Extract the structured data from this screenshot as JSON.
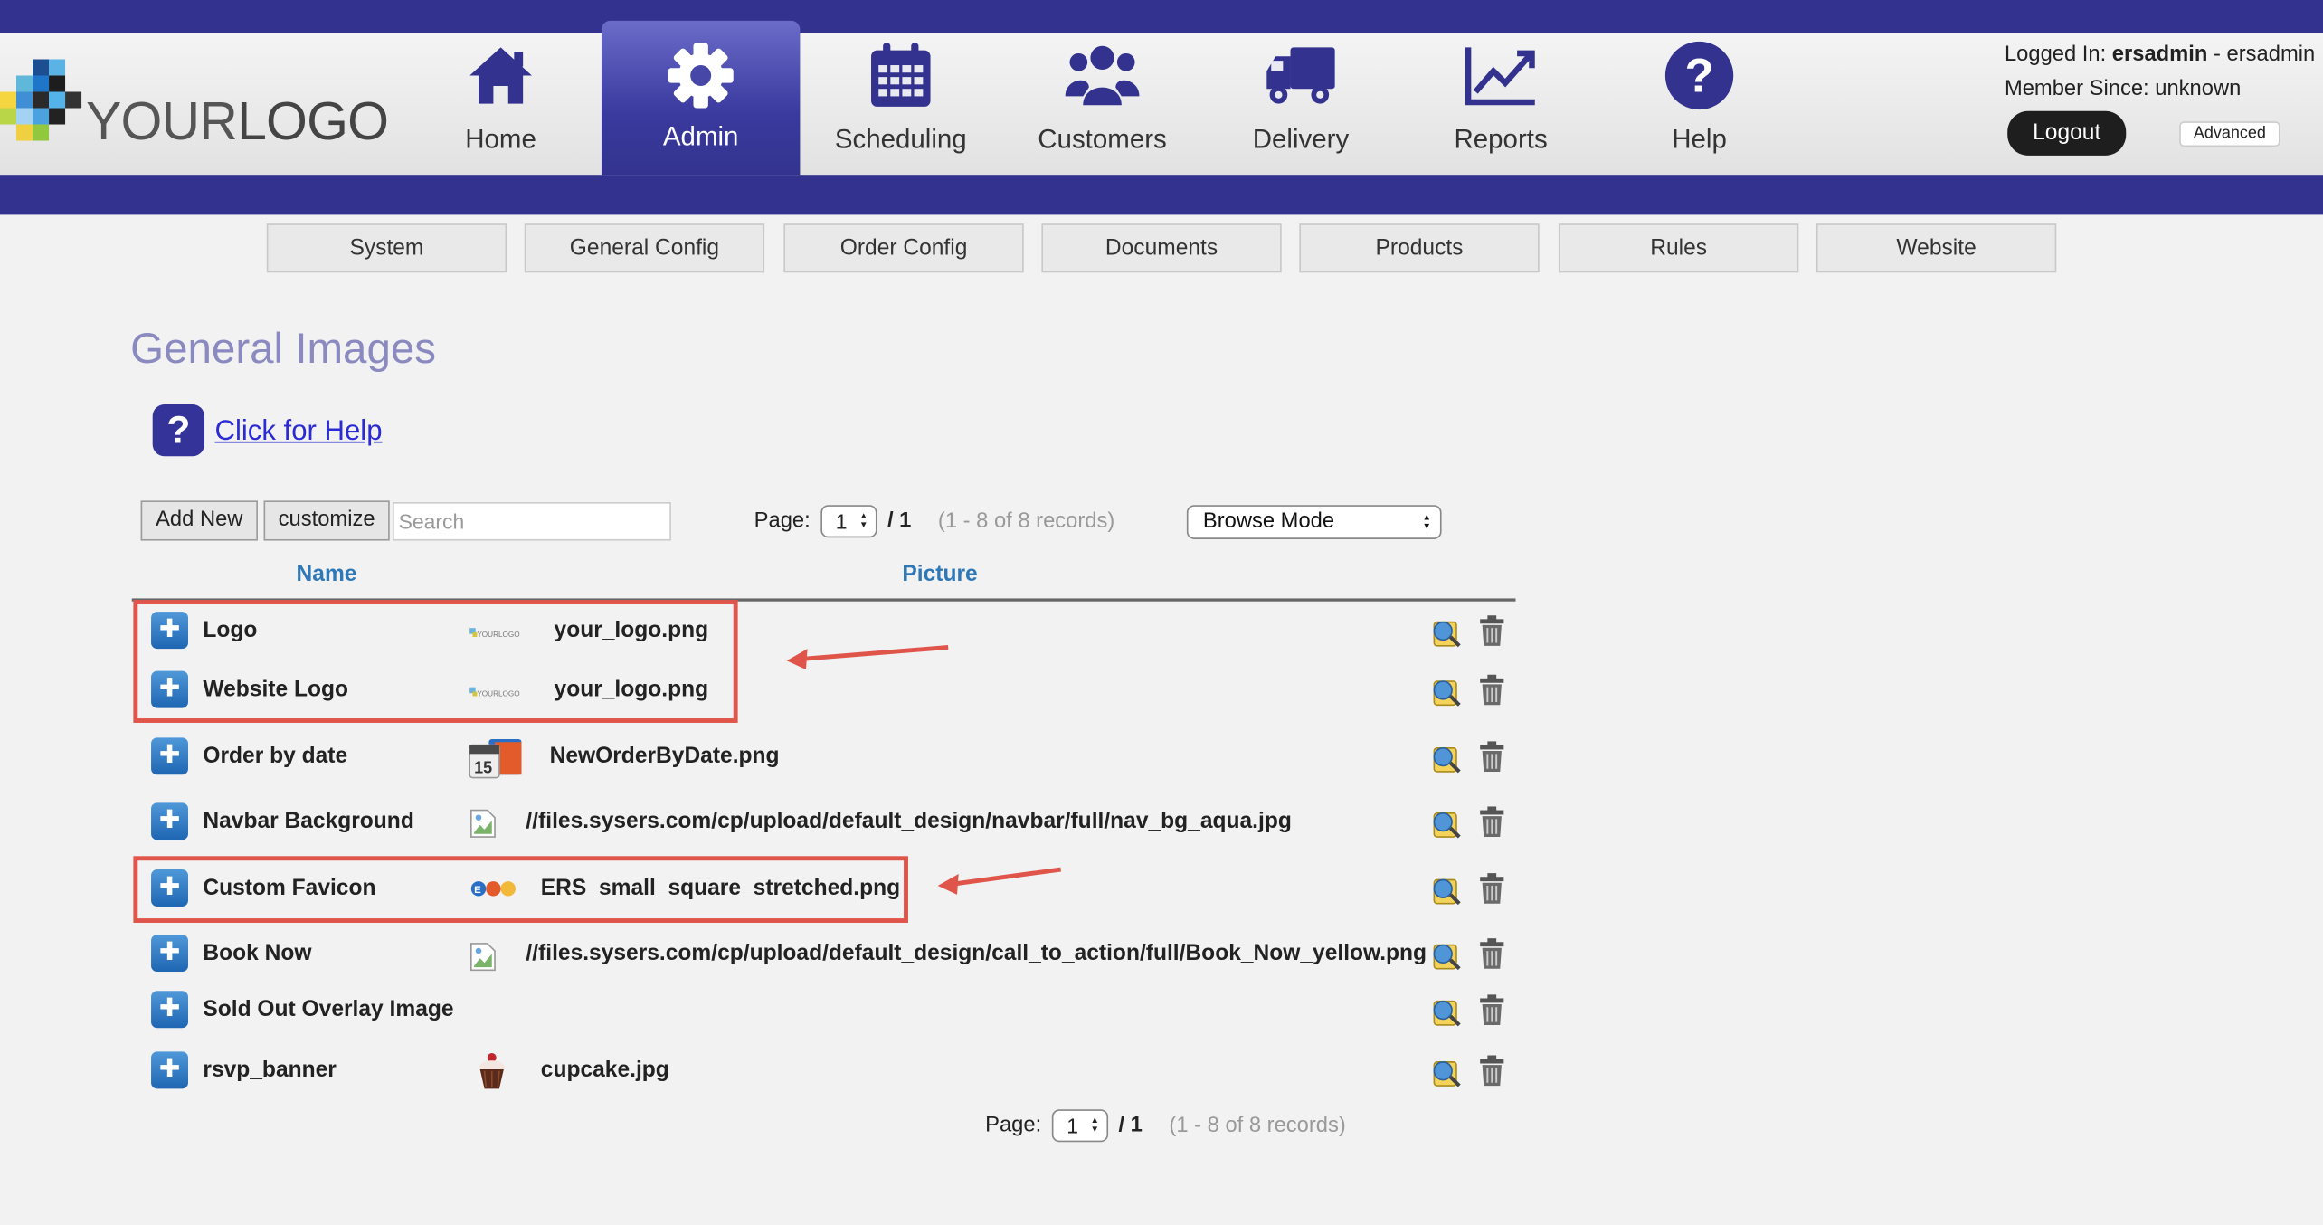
{
  "brand": {
    "logo_text_1": "YOUR",
    "logo_text_2": "LOGO"
  },
  "nav": [
    {
      "label": "Home",
      "icon": "home-icon"
    },
    {
      "label": "Admin",
      "icon": "gear-icon",
      "active": true
    },
    {
      "label": "Scheduling",
      "icon": "calendar-icon"
    },
    {
      "label": "Customers",
      "icon": "users-icon"
    },
    {
      "label": "Delivery",
      "icon": "truck-icon"
    },
    {
      "label": "Reports",
      "icon": "chart-icon"
    },
    {
      "label": "Help",
      "icon": "question-icon"
    }
  ],
  "account": {
    "logged_in_label": "Logged In:",
    "username": "ersadmin",
    "username_suffix": "- ersadmin",
    "member_since": "Member Since: unknown",
    "logout_label": "Logout",
    "advanced_label": "Advanced"
  },
  "subtabs": [
    "System",
    "General Config",
    "Order Config",
    "Documents",
    "Products",
    "Rules",
    "Website"
  ],
  "page": {
    "title": "General Images",
    "help_link": "Click for Help"
  },
  "toolbar": {
    "add_new": "Add New",
    "customize": "customize",
    "search_placeholder": "Search",
    "page_label": "Page:",
    "page_value": "1",
    "page_total": "/ 1",
    "records": "(1 - 8 of 8 records)",
    "browse_mode": "Browse Mode"
  },
  "table": {
    "columns": [
      "Name",
      "Picture"
    ],
    "rows": [
      {
        "name": "Logo",
        "file": "your_logo.png",
        "thumb": "logo"
      },
      {
        "name": "Website Logo",
        "file": "your_logo.png",
        "thumb": "logo"
      },
      {
        "name": "Order by date",
        "file": "NewOrderByDate.png",
        "thumb": "calendar"
      },
      {
        "name": "Navbar Background",
        "file": "//files.sysers.com/cp/upload/default_design/navbar/full/nav_bg_aqua.jpg",
        "thumb": "broken"
      },
      {
        "name": "Custom Favicon",
        "file": "ERS_small_square_stretched.png",
        "thumb": "ers"
      },
      {
        "name": "Book Now",
        "file": "//files.sysers.com/cp/upload/default_design/call_to_action/full/Book_Now_yellow.png",
        "thumb": "broken"
      },
      {
        "name": "Sold Out Overlay Image",
        "file": "",
        "thumb": "none"
      },
      {
        "name": "rsvp_banner",
        "file": "cupcake.jpg",
        "thumb": "cupcake"
      }
    ]
  },
  "footer_pager": {
    "page_label": "Page:",
    "page_value": "1",
    "page_total": "/ 1",
    "records": "(1 - 8 of 8 records)"
  },
  "colors": {
    "nav_bar": "#33338f",
    "title": "#8a8ac0",
    "column_header": "#2e78b8",
    "highlight": "#e0554a"
  }
}
